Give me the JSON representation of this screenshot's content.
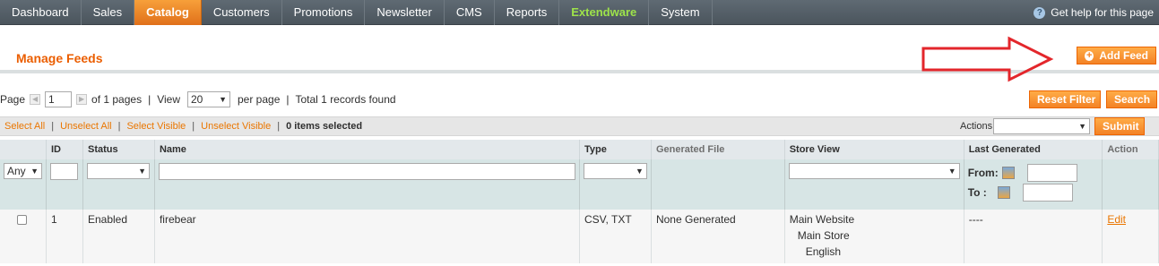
{
  "nav": {
    "items": [
      {
        "label": "Dashboard"
      },
      {
        "label": "Sales"
      },
      {
        "label": "Catalog"
      },
      {
        "label": "Customers"
      },
      {
        "label": "Promotions"
      },
      {
        "label": "Newsletter"
      },
      {
        "label": "CMS"
      },
      {
        "label": "Reports"
      },
      {
        "label": "Extendware"
      },
      {
        "label": "System"
      }
    ],
    "active": "Catalog",
    "help_label": "Get help for this page"
  },
  "page": {
    "title": "Manage Feeds",
    "add_button": "Add Feed"
  },
  "pager": {
    "page_label": "Page",
    "page_value": "1",
    "of_pages": "of 1 pages",
    "view_label": "View",
    "view_value": "20",
    "per_page": "per page",
    "records": "Total 1 records found",
    "reset_button": "Reset Filter",
    "search_button": "Search"
  },
  "massaction": {
    "select_all": "Select All",
    "unselect_all": "Unselect All",
    "select_visible": "Select Visible",
    "unselect_visible": "Unselect Visible",
    "items_selected": "0 items selected",
    "actions_label": "Actions",
    "submit_button": "Submit"
  },
  "grid": {
    "headers": {
      "id": "ID",
      "status": "Status",
      "name": "Name",
      "type": "Type",
      "generated_file": "Generated File",
      "store_view": "Store View",
      "last_generated": "Last Generated",
      "action": "Action"
    },
    "filter": {
      "any": "Any",
      "from": "From:",
      "to": "To :"
    },
    "rows": [
      {
        "id": "1",
        "status": "Enabled",
        "name": "firebear",
        "type": "CSV, TXT",
        "generated_file": "None Generated",
        "store_website": "Main Website",
        "store_store": "Main Store",
        "store_view": "English",
        "last_generated": "----",
        "action": "Edit"
      }
    ]
  },
  "colors": {
    "accent": "#eb5e00",
    "button": "#f38226",
    "nav_bg": "#4b555d",
    "extendware": "#9ee34a",
    "annotation_arrow": "#e3262b"
  }
}
